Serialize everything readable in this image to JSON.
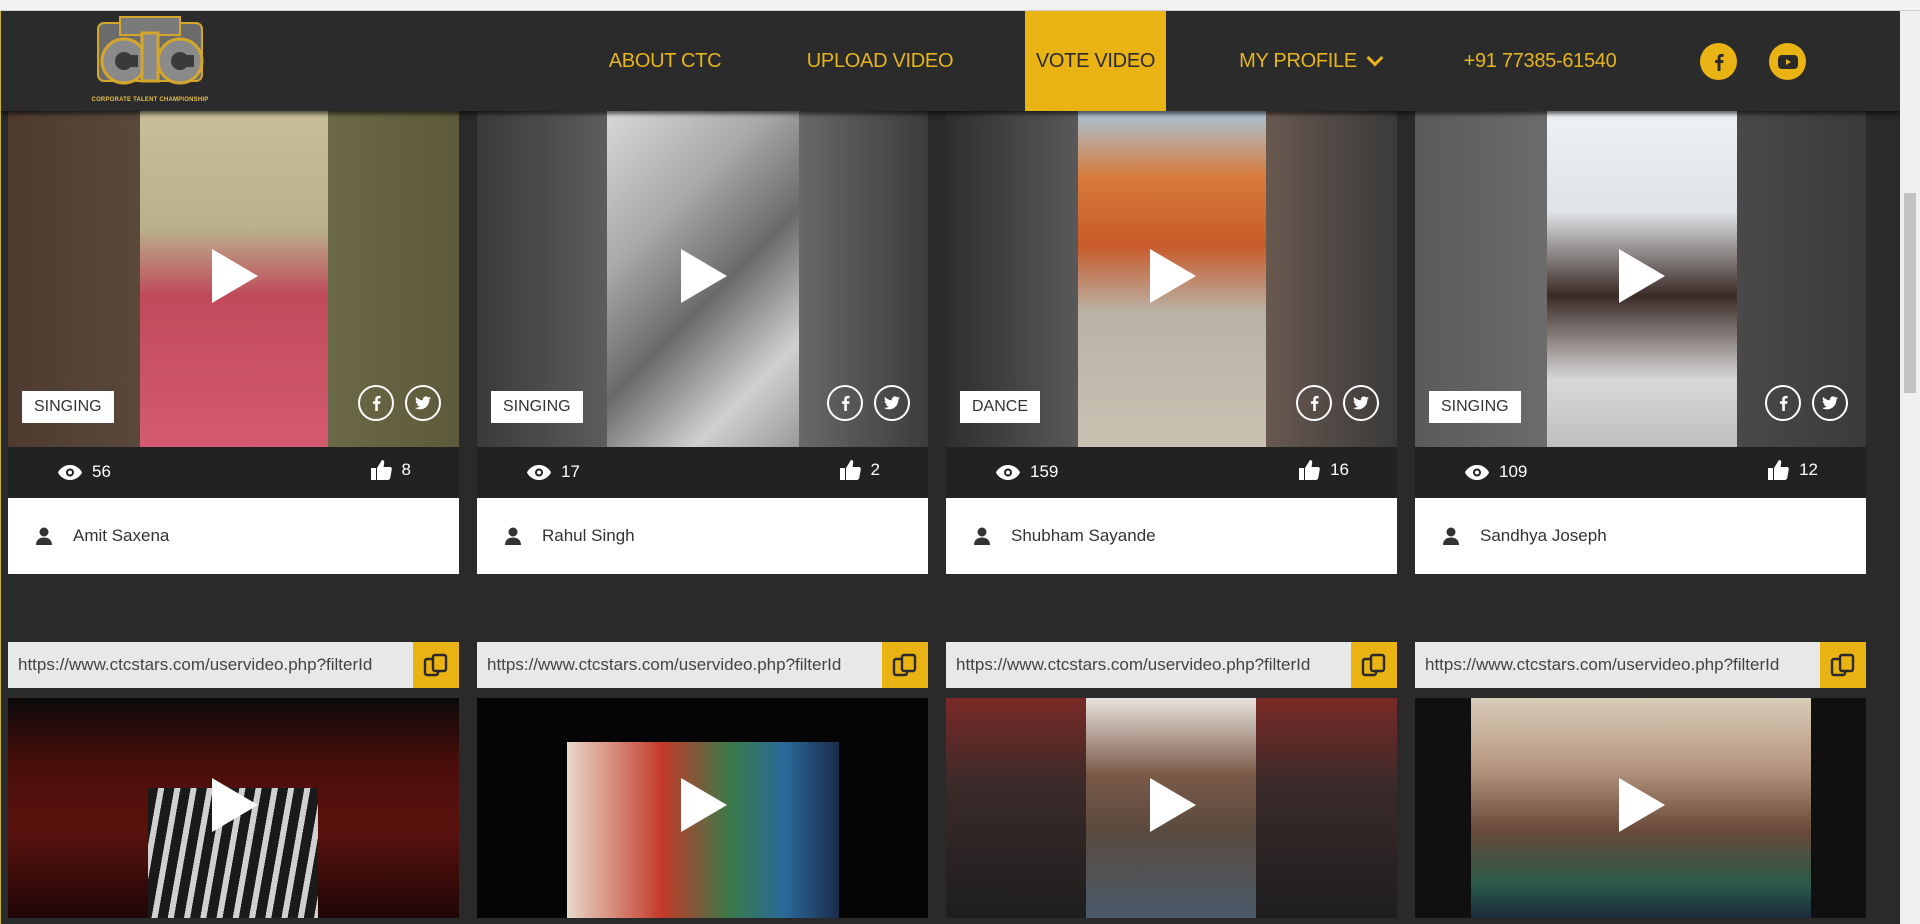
{
  "brand": {
    "logo_text": "CTC",
    "tagline": "CORPORATE TALENT CHAMPIONSHIP"
  },
  "nav": {
    "about": "ABOUT CTC",
    "upload": "UPLOAD VIDEO",
    "vote": "VOTE VIDEO",
    "profile": "MY PROFILE",
    "phone": "+91 77385-61540"
  },
  "social_icons": [
    "facebook-icon",
    "youtube-icon"
  ],
  "colors": {
    "accent": "#e8b313",
    "header_bg": "#2b2b2b",
    "stats_bg": "#222222"
  },
  "videos": [
    {
      "category": "SINGING",
      "views": "56",
      "likes": "8",
      "name": "Amit Saxena"
    },
    {
      "category": "SINGING",
      "views": "17",
      "likes": "2",
      "name": "Rahul Singh"
    },
    {
      "category": "DANCE",
      "views": "159",
      "likes": "16",
      "name": "Shubham Sayande"
    },
    {
      "category": "SINGING",
      "views": "109",
      "likes": "12",
      "name": "Sandhya Joseph"
    }
  ],
  "share_urls": [
    "https://www.ctcstars.com/uservideo.php?filterId",
    "https://www.ctcstars.com/uservideo.php?filterId",
    "https://www.ctcstars.com/uservideo.php?filterId",
    "https://www.ctcstars.com/uservideo.php?filterId"
  ]
}
